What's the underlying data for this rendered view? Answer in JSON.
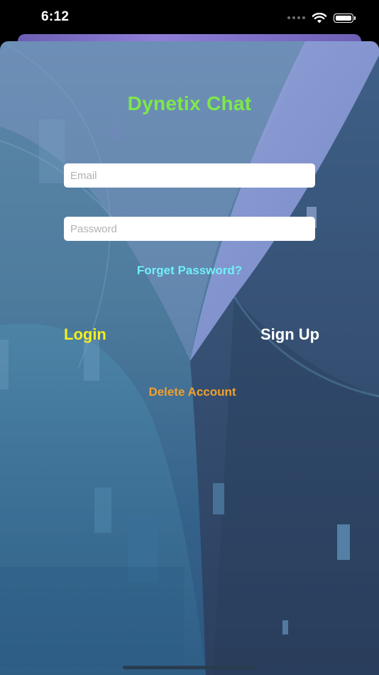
{
  "status_bar": {
    "time": "6:12",
    "icons": [
      "signal-dots-icon",
      "wifi-icon",
      "battery-icon"
    ]
  },
  "app": {
    "title": "Dynetix Chat"
  },
  "login_form": {
    "email_placeholder": "Email",
    "email_value": "",
    "password_placeholder": "Password",
    "password_value": "",
    "forgot_label": "Forget Password?",
    "login_label": "Login",
    "signup_label": "Sign Up",
    "delete_label": "Delete Account"
  },
  "colors": {
    "title": "#7ee84a",
    "forgot": "#6ff0f7",
    "login": "#f4ee22",
    "signup": "#ffffff",
    "delete": "#f0a02e",
    "background": "#4e7c9d"
  }
}
